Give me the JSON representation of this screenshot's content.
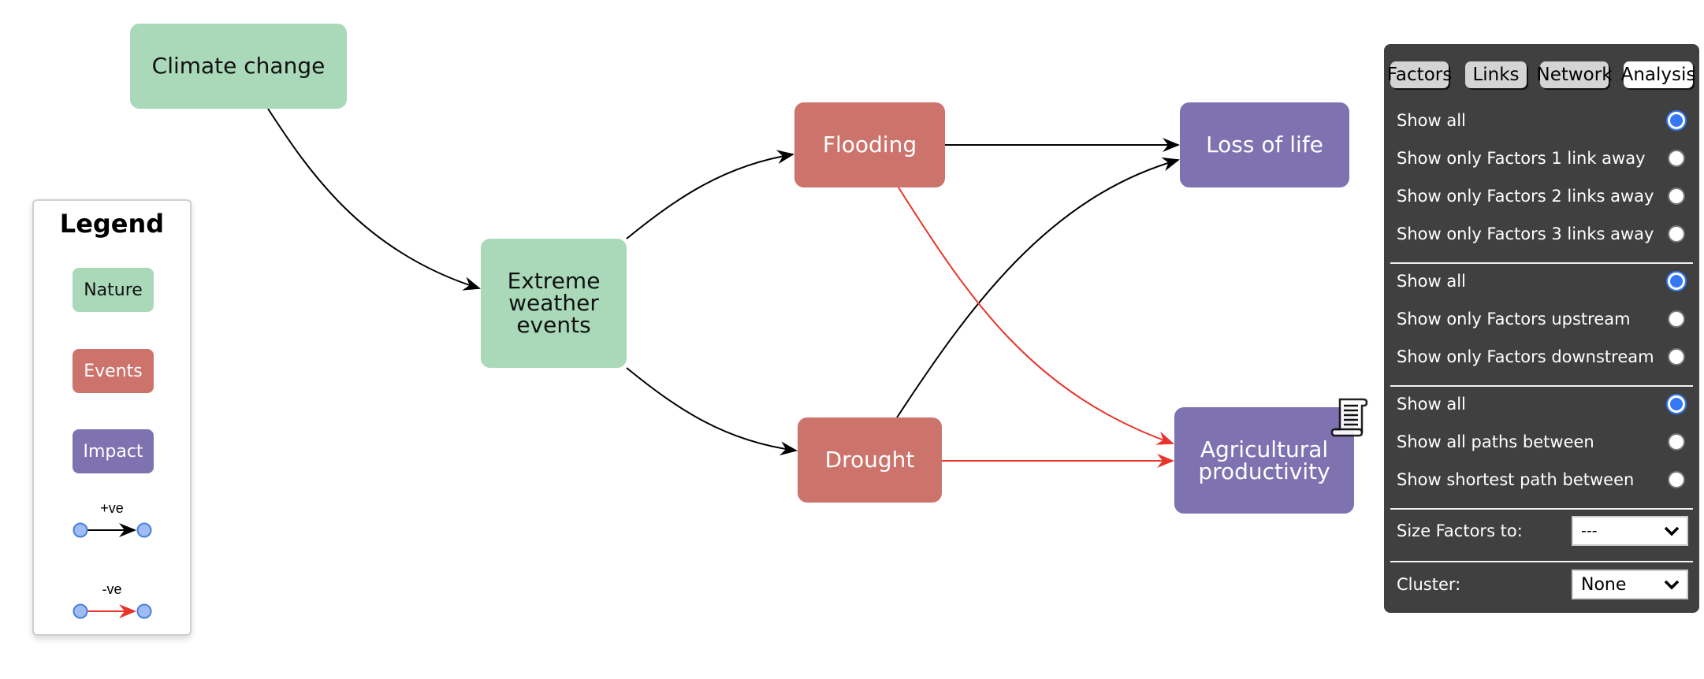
{
  "colors": {
    "nature": "#a9d9b8",
    "events": "#cc736c",
    "impact": "#7f72b1",
    "positive_edge": "#000000",
    "negative_edge": "#e8352b",
    "panel_bg": "#404040",
    "radio_selected": "#3478f6"
  },
  "nodes": [
    {
      "id": "climate",
      "label": "Climate change",
      "group": "nature"
    },
    {
      "id": "extreme",
      "label": "Extreme weather events",
      "group": "nature"
    },
    {
      "id": "flooding",
      "label": "Flooding",
      "group": "events"
    },
    {
      "id": "drought",
      "label": "Drought",
      "group": "events"
    },
    {
      "id": "loss",
      "label": "Loss of life",
      "group": "impact"
    },
    {
      "id": "agri",
      "label": "Agricultural productivity",
      "group": "impact",
      "has_note": true
    }
  ],
  "edges": [
    {
      "from": "climate",
      "to": "extreme",
      "sign": "+ve"
    },
    {
      "from": "extreme",
      "to": "flooding",
      "sign": "+ve"
    },
    {
      "from": "extreme",
      "to": "drought",
      "sign": "+ve"
    },
    {
      "from": "flooding",
      "to": "loss",
      "sign": "+ve"
    },
    {
      "from": "drought",
      "to": "loss",
      "sign": "+ve"
    },
    {
      "from": "flooding",
      "to": "agri",
      "sign": "-ve"
    },
    {
      "from": "drought",
      "to": "agri",
      "sign": "-ve"
    }
  ],
  "legend": {
    "title": "Legend",
    "groups": [
      "Nature",
      "Events",
      "Impact"
    ],
    "edge_types": [
      "+ve",
      "-ve"
    ]
  },
  "panel": {
    "tabs": [
      {
        "label": "Factors",
        "active": false
      },
      {
        "label": "Links",
        "active": false
      },
      {
        "label": "Network",
        "active": false
      },
      {
        "label": "Analysis",
        "active": true
      }
    ],
    "radio_groups": [
      {
        "options": [
          {
            "label": "Show all",
            "selected": true
          },
          {
            "label": "Show only Factors 1 link away",
            "selected": false
          },
          {
            "label": "Show only Factors 2 links away",
            "selected": false
          },
          {
            "label": "Show only Factors 3 links away",
            "selected": false
          }
        ]
      },
      {
        "options": [
          {
            "label": "Show all",
            "selected": true
          },
          {
            "label": "Show only Factors upstream",
            "selected": false
          },
          {
            "label": "Show only Factors downstream",
            "selected": false
          }
        ]
      },
      {
        "options": [
          {
            "label": "Show all",
            "selected": true
          },
          {
            "label": "Show all paths between",
            "selected": false
          },
          {
            "label": "Show shortest path between",
            "selected": false
          }
        ]
      }
    ],
    "size_factors": {
      "label": "Size Factors to:",
      "value": "---"
    },
    "cluster": {
      "label": "Cluster:",
      "value": "None"
    }
  }
}
